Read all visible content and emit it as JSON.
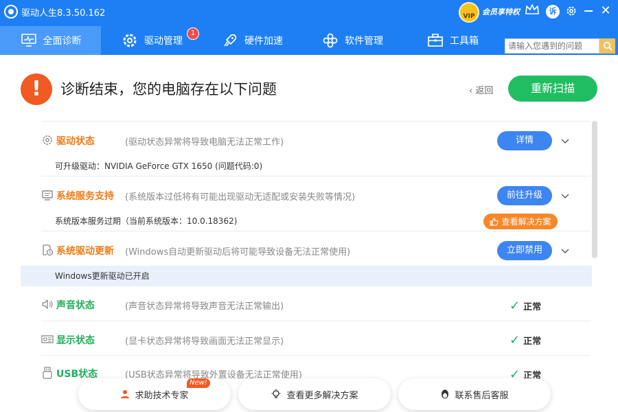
{
  "app": {
    "title": "驱动人生8.3.50.162"
  },
  "topbar": {
    "vip_label": "VIP",
    "vip_text": "会员享特权",
    "avatar_letter": "诉"
  },
  "nav": {
    "tabs": [
      {
        "label": "全面诊断",
        "icon": "monitor-icon",
        "active": true
      },
      {
        "label": "驱动管理",
        "icon": "gear-icon",
        "badge": "1"
      },
      {
        "label": "硬件加速",
        "icon": "rocket-icon"
      },
      {
        "label": "软件管理",
        "icon": "apps-icon"
      },
      {
        "label": "工具箱",
        "icon": "toolbox-icon"
      }
    ],
    "search_placeholder": "请输入您遇到的问题"
  },
  "header": {
    "title": "诊断结束，您的电脑存在以下问题",
    "back": "返回",
    "rescan": "重新扫描"
  },
  "rows": [
    {
      "title": "驱动状态",
      "desc": "(驱动状态异常将导致电脑无法正常工作)",
      "action": "详情",
      "detail": "可升级驱动：NVIDIA GeForce GTX 1650 (问题代码:0)"
    },
    {
      "title": "系统服务支持",
      "desc": "(系统版本过低将有可能出现驱动无适配或安装失败等情况)",
      "action": "前往升级",
      "detail": "系统版本服务过期（当前系统版本：10.0.18362)",
      "solution": "查看解决方案"
    },
    {
      "title": "系统驱动更新",
      "desc": "(Windows自动更新驱动后将可能导致设备无法正常使用)",
      "action": "立即禁用",
      "detail": "Windows更新驱动已开启"
    },
    {
      "title": "声音状态",
      "desc": "(声音状态异常将导致声音无法正常输出)",
      "status": "正常"
    },
    {
      "title": "显示状态",
      "desc": "(显卡状态异常将导致画面无法正常显示)",
      "status": "正常"
    },
    {
      "title": "USB状态",
      "desc": "(USB状态异常将导致外置设备无法正常使用)",
      "status": "正常"
    }
  ],
  "bottom": {
    "expert": "求助技术专家",
    "expert_tag": "New!",
    "more_solutions": "查看更多解决方案",
    "service": "联系售后客服"
  },
  "colors": {
    "brand": "#1e7ff5",
    "primary_btn": "#3d85f0",
    "rescan": "#21bd63",
    "warning": "#f07b16",
    "ok": "#21ad5a",
    "alert": "#f15a22"
  }
}
